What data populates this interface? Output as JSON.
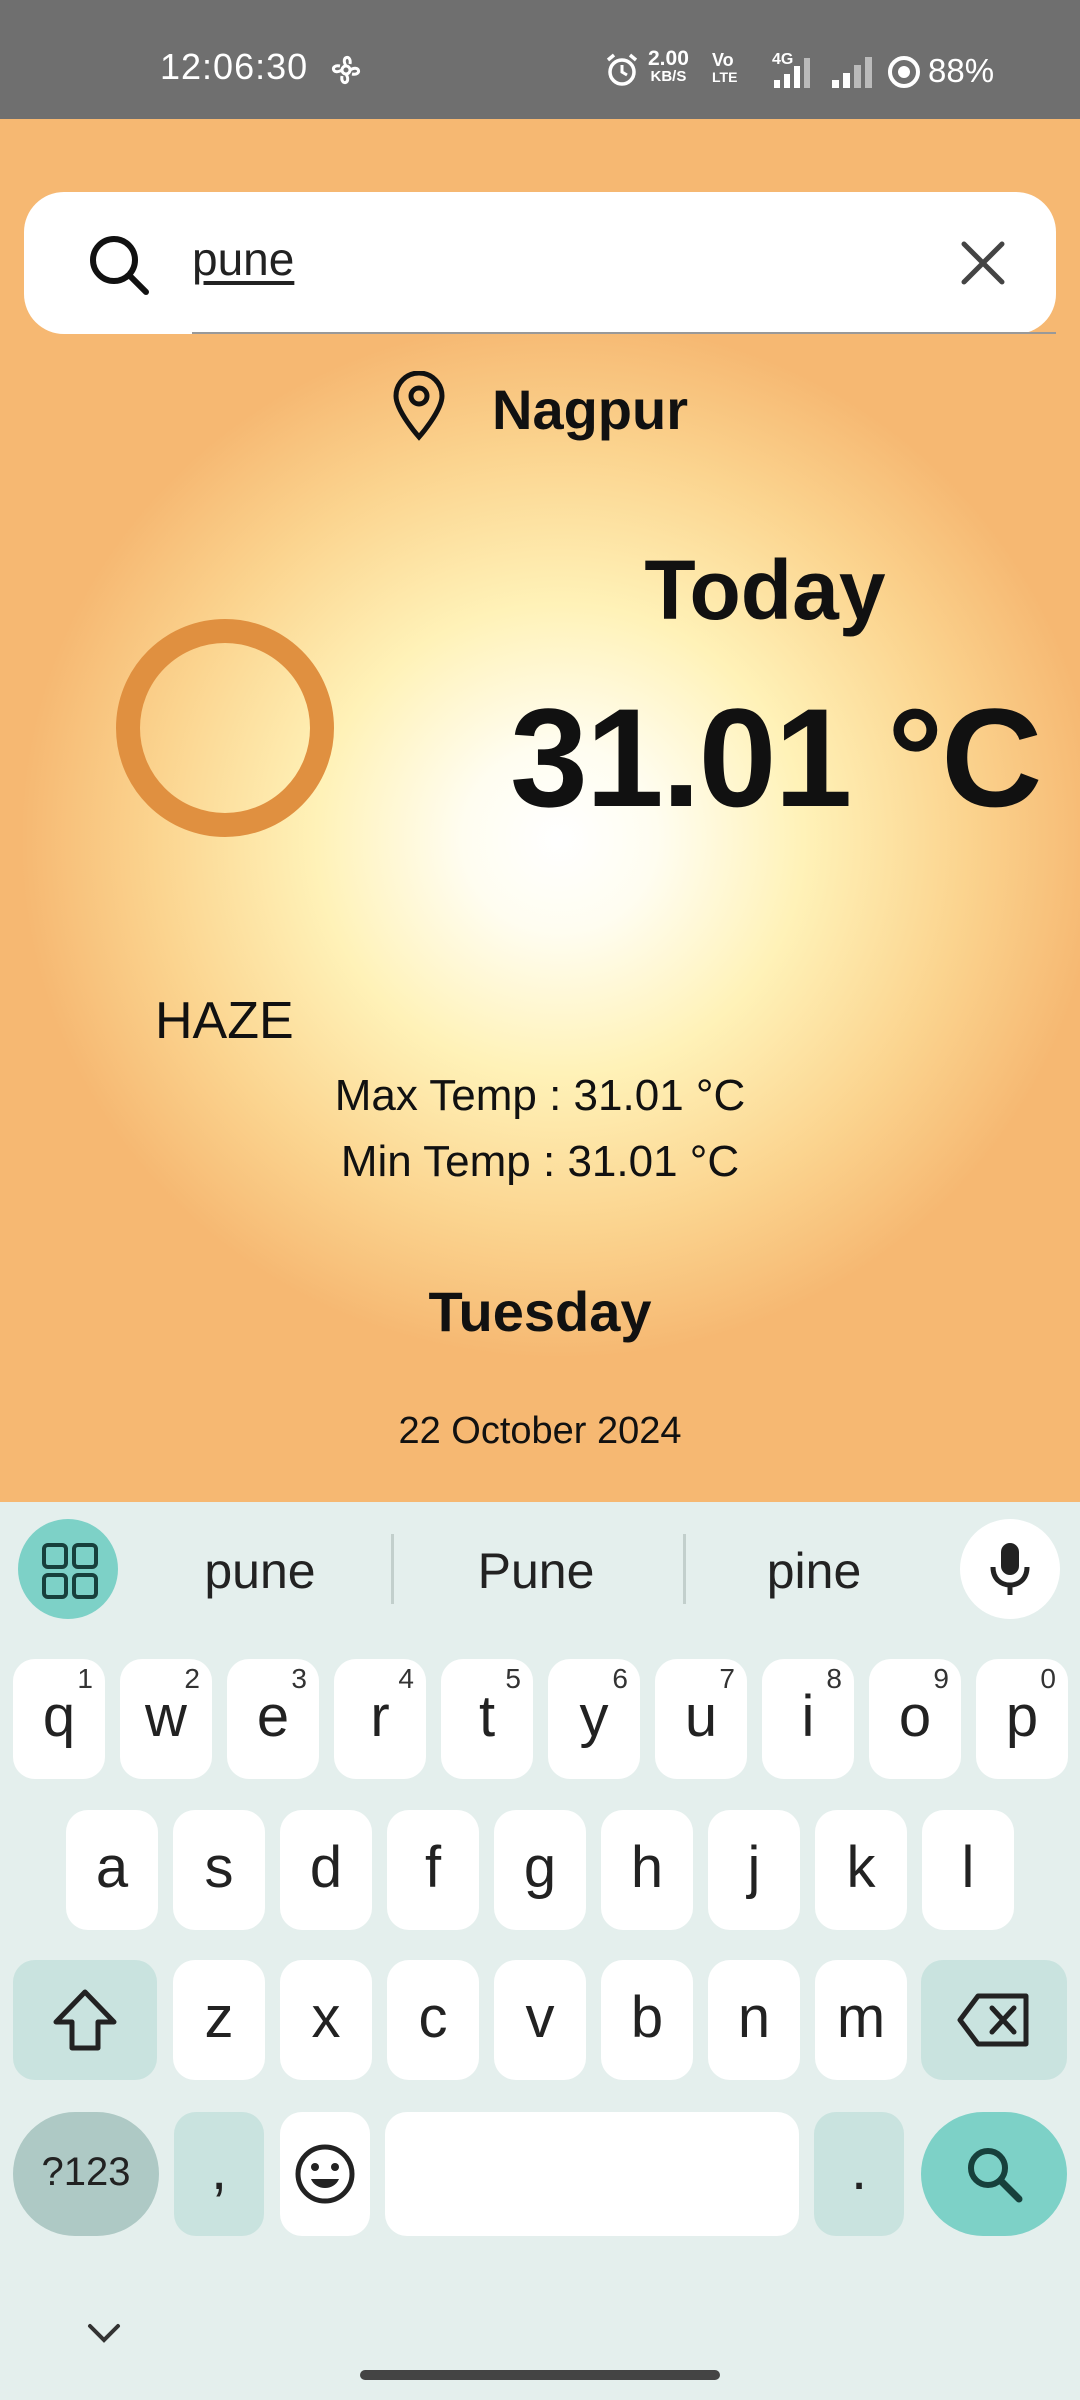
{
  "status_bar": {
    "time": "12:06:30",
    "net_speed_value": "2.00",
    "net_speed_unit": "KB/S",
    "volte_line1": "Vo",
    "volte_line2": "LTE",
    "network": "4G",
    "battery": "88%"
  },
  "search": {
    "value": "pune"
  },
  "location": {
    "city": "Nagpur"
  },
  "weather": {
    "day_label": "Today",
    "temperature": "31.01 °C",
    "condition": "HAZE",
    "max_temp": "Max Temp : 31.01 °C",
    "min_temp": "Min Temp : 31.01 °C",
    "weekday": "Tuesday",
    "date": "22 October 2024"
  },
  "colors": {
    "sun_ring": "#e09040",
    "keyboard_accent": "#7dd1c7"
  },
  "keyboard": {
    "suggestions": [
      "pune",
      "Pune",
      "pine"
    ],
    "row1": [
      {
        "k": "q",
        "s": "1"
      },
      {
        "k": "w",
        "s": "2"
      },
      {
        "k": "e",
        "s": "3"
      },
      {
        "k": "r",
        "s": "4"
      },
      {
        "k": "t",
        "s": "5"
      },
      {
        "k": "y",
        "s": "6"
      },
      {
        "k": "u",
        "s": "7"
      },
      {
        "k": "i",
        "s": "8"
      },
      {
        "k": "o",
        "s": "9"
      },
      {
        "k": "p",
        "s": "0"
      }
    ],
    "row2": [
      "a",
      "s",
      "d",
      "f",
      "g",
      "h",
      "j",
      "k",
      "l"
    ],
    "row3": [
      "z",
      "x",
      "c",
      "v",
      "b",
      "n",
      "m"
    ],
    "num_key": "?123",
    "comma_key": ",",
    "period_key": "."
  }
}
